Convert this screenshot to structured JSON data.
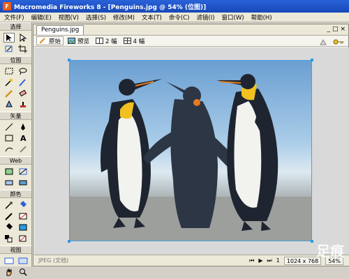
{
  "window": {
    "title": "Macromedia Fireworks 8 - [Penguins.jpg @ 54% (位图)]"
  },
  "menu": [
    "文件(F)",
    "编辑(E)",
    "视图(V)",
    "选择(S)",
    "修改(M)",
    "文本(T)",
    "命令(C)",
    "滤镜(I)",
    "窗口(W)",
    "帮助(H)"
  ],
  "tools": {
    "sections": [
      "选择",
      "位图",
      "矢量",
      "Web",
      "颜色",
      "视图"
    ]
  },
  "document": {
    "tab": "Penguins.jpg",
    "views": [
      "原始",
      "预览",
      "2 幅",
      "4 幅"
    ],
    "window_controls": [
      "_",
      "□",
      "×"
    ]
  },
  "status": {
    "left": "JPEG (文档)",
    "page": "1",
    "size": "1024 x 768",
    "zoom": "54%"
  },
  "watermark": "足痕",
  "colors": {
    "selection": "#2b9be4",
    "titlebar": "#2a62d8"
  }
}
